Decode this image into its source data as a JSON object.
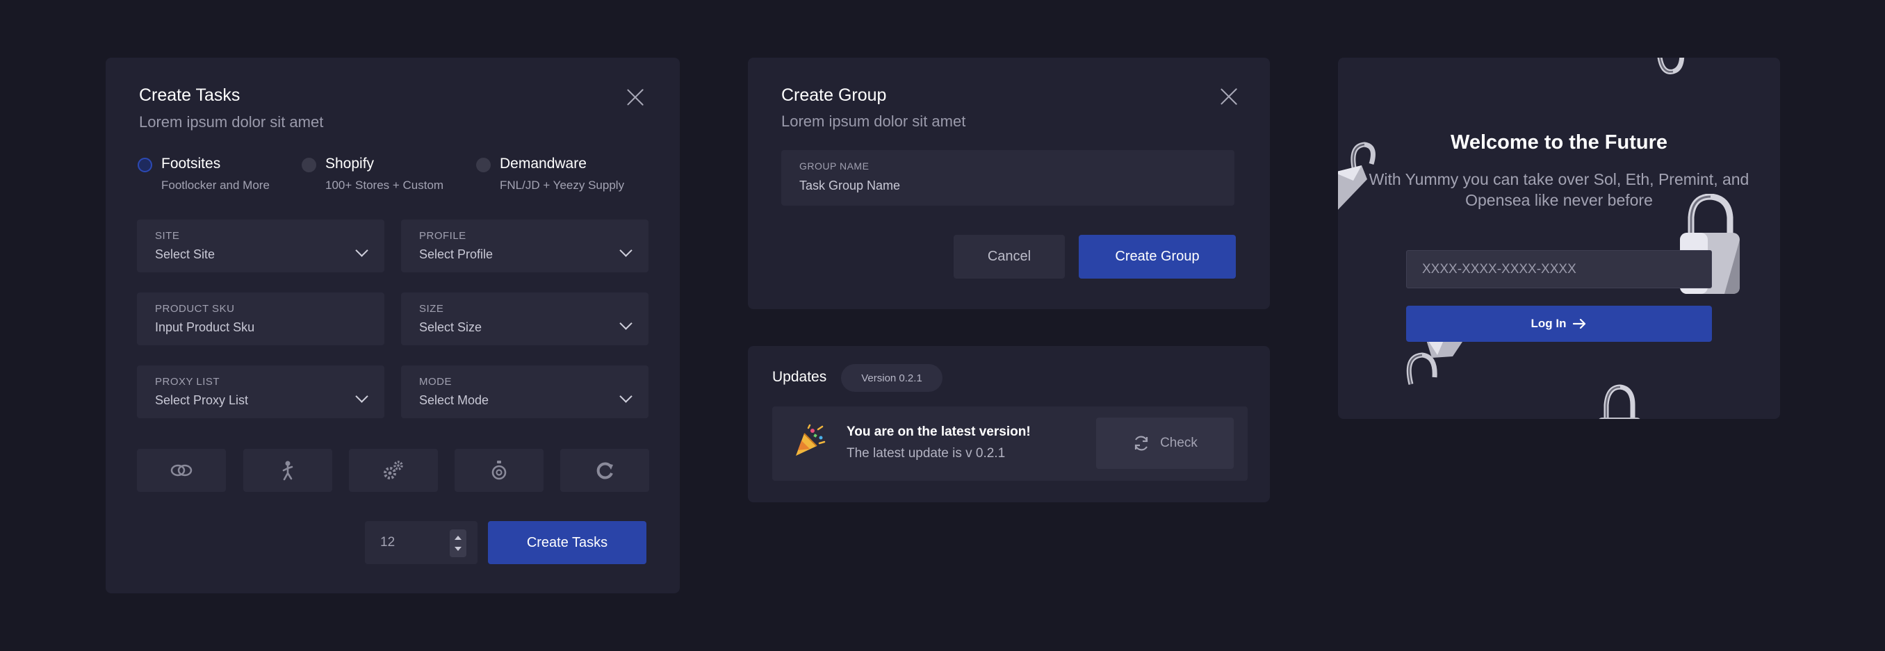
{
  "create_tasks": {
    "title": "Create Tasks",
    "subtitle": "Lorem ipsum dolor sit amet",
    "platforms": [
      {
        "label": "Footsites",
        "desc": "Footlocker and More",
        "selected": true
      },
      {
        "label": "Shopify",
        "desc": "100+ Stores + Custom",
        "selected": false
      },
      {
        "label": "Demandware",
        "desc": "FNL/JD + Yeezy Supply",
        "selected": false
      }
    ],
    "fields": {
      "site": {
        "label": "SITE",
        "value": "Select Site"
      },
      "profile": {
        "label": "PROFILE",
        "value": "Select Profile"
      },
      "product_sku": {
        "label": "PRODUCT SKU",
        "value": "Input Product Sku"
      },
      "size": {
        "label": "SIZE",
        "value": "Select Size"
      },
      "proxy_list": {
        "label": "PROXY LIST",
        "value": "Select Proxy List"
      },
      "mode": {
        "label": "MODE",
        "value": "Select Mode"
      }
    },
    "tool_icons": [
      "links-icon",
      "running-person-icon",
      "gears-icon",
      "stopwatch-icon",
      "refresh-icon"
    ],
    "quantity": "12",
    "submit_label": "Create Tasks"
  },
  "create_group": {
    "title": "Create Group",
    "subtitle": "Lorem ipsum dolor sit amet",
    "group_name_label": "GROUP NAME",
    "group_name_placeholder": "Task Group Name",
    "cancel_label": "Cancel",
    "submit_label": "Create Group"
  },
  "updates": {
    "title": "Updates",
    "version_badge": "Version 0.2.1",
    "status_title": "You are on the latest version!",
    "status_detail": "The latest update is v 0.2.1",
    "check_label": "Check",
    "status_icon": "party-popper-icon"
  },
  "welcome": {
    "title": "Welcome to the Future",
    "subtitle": "With Yummy you can take over Sol, Eth, Premint, and Opensea like never before",
    "key_placeholder": "XXXX-XXXX-XXXX-XXXX",
    "login_label": "Log In",
    "decor_icon": "padlock-icon"
  },
  "colors": {
    "background": "#181824",
    "panel": "#222232",
    "field": "#2a2a3b",
    "accent": "#2a44a8"
  }
}
